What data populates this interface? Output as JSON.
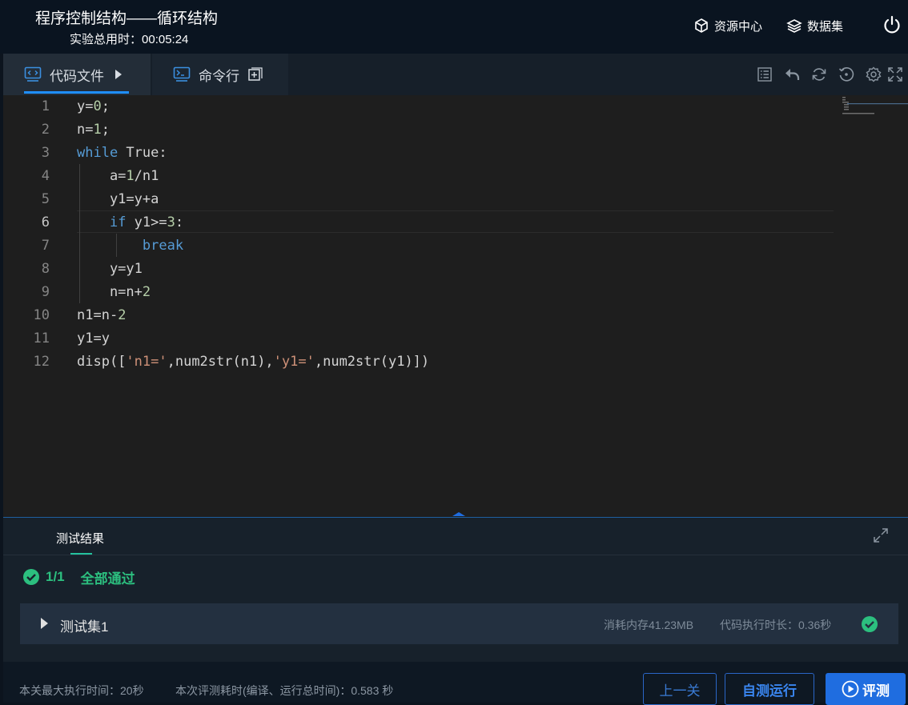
{
  "header": {
    "title": "程序控制结构——循环结构",
    "timer_label": "实验总用时：",
    "timer_value": "00:05:24",
    "resource_center": "资源中心",
    "datasets": "数据集"
  },
  "tabs": {
    "code_files": "代码文件",
    "command_line": "命令行"
  },
  "editor": {
    "lines": [
      {
        "n": "1",
        "tokens": [
          {
            "t": "y=",
            "c": ""
          },
          {
            "t": "0",
            "c": "num"
          },
          {
            "t": ";",
            "c": ""
          }
        ]
      },
      {
        "n": "2",
        "tokens": [
          {
            "t": "n=",
            "c": ""
          },
          {
            "t": "1",
            "c": "num"
          },
          {
            "t": ";",
            "c": ""
          }
        ]
      },
      {
        "n": "3",
        "tokens": [
          {
            "t": "while",
            "c": "kw"
          },
          {
            "t": " True:",
            "c": ""
          }
        ]
      },
      {
        "n": "4",
        "tokens": [
          {
            "t": "    a=",
            "c": ""
          },
          {
            "t": "1",
            "c": "num"
          },
          {
            "t": "/n1",
            "c": ""
          }
        ]
      },
      {
        "n": "5",
        "tokens": [
          {
            "t": "    y1=y+a",
            "c": ""
          }
        ]
      },
      {
        "n": "6",
        "tokens": [
          {
            "t": "    ",
            "c": ""
          },
          {
            "t": "if",
            "c": "kw"
          },
          {
            "t": " y1>=",
            "c": ""
          },
          {
            "t": "3",
            "c": "num"
          },
          {
            "t": ":",
            "c": ""
          }
        ]
      },
      {
        "n": "7",
        "tokens": [
          {
            "t": "        ",
            "c": ""
          },
          {
            "t": "break",
            "c": "kw"
          }
        ]
      },
      {
        "n": "8",
        "tokens": [
          {
            "t": "    y=y1",
            "c": ""
          }
        ]
      },
      {
        "n": "9",
        "tokens": [
          {
            "t": "    n=n+",
            "c": ""
          },
          {
            "t": "2",
            "c": "num"
          }
        ]
      },
      {
        "n": "10",
        "tokens": [
          {
            "t": "n1=n-",
            "c": ""
          },
          {
            "t": "2",
            "c": "num"
          }
        ]
      },
      {
        "n": "11",
        "tokens": [
          {
            "t": "y1=y",
            "c": ""
          }
        ]
      },
      {
        "n": "12",
        "tokens": [
          {
            "t": "disp([",
            "c": ""
          },
          {
            "t": "'n1='",
            "c": "str"
          },
          {
            "t": ",num2str(n1),",
            "c": ""
          },
          {
            "t": "'y1='",
            "c": "str"
          },
          {
            "t": ",num2str(y1)])",
            "c": ""
          }
        ]
      }
    ],
    "current_line": 6
  },
  "results": {
    "tab_label": "测试结果",
    "pass_count": "1/1",
    "pass_text": "全部通过",
    "testset_name": "测试集1",
    "memory": "消耗内存41.23MB",
    "exec_time": "代码执行时长：0.36秒"
  },
  "footer": {
    "max_exec": "本关最大执行时间：20秒",
    "this_eval": "本次评测耗时(编译、运行总时间)：0.583 秒",
    "prev_button": "上一关",
    "self_test_button": "自测运行",
    "evaluate_button": "评测"
  },
  "colors": {
    "accent": "#1f6de0",
    "success": "#2cbf7f",
    "keyword": "#569cd6",
    "number": "#b5cea8",
    "string": "#ce9178"
  }
}
